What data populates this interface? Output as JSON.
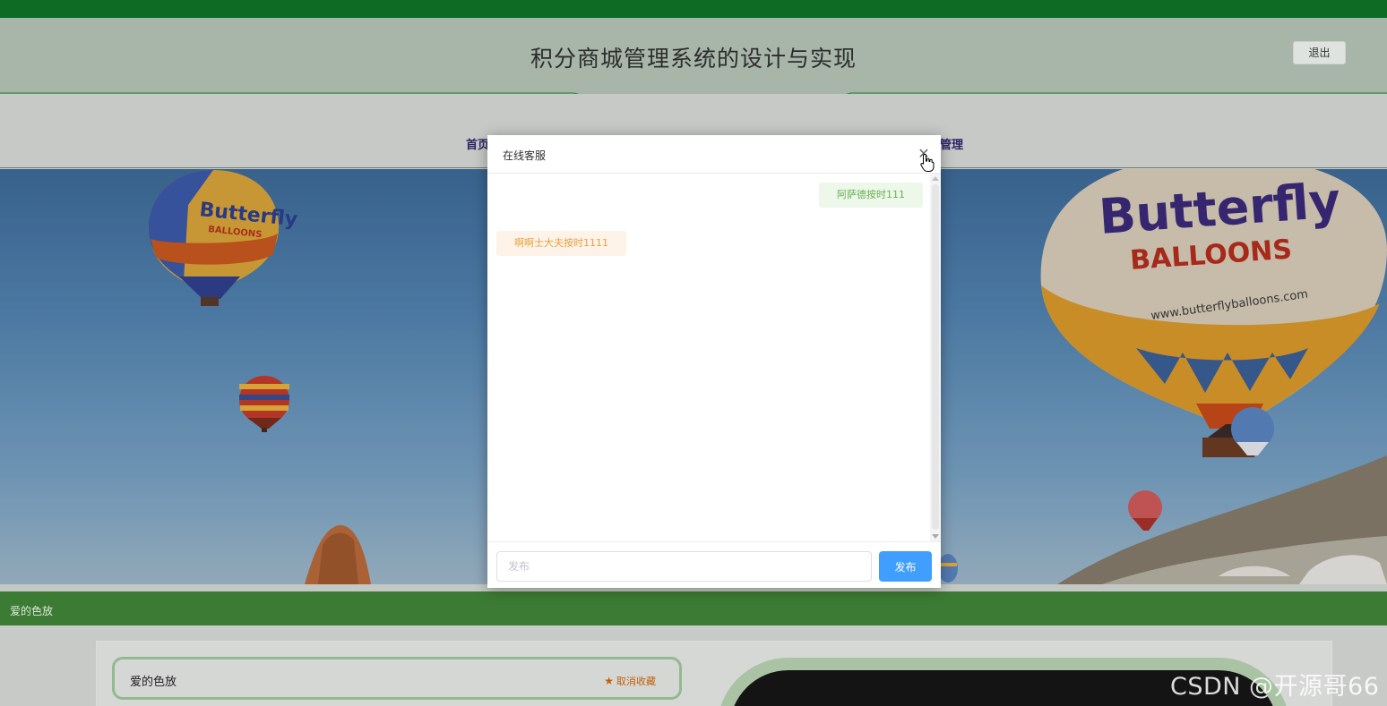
{
  "header": {
    "title": "积分商城管理系统的设计与实现",
    "logout_label": "退出"
  },
  "nav": {
    "home_partial": "首页",
    "manage_partial": "管理"
  },
  "banner": {
    "balloon_brand": "Butterfly",
    "balloon_sub": "BALLOONS",
    "balloon_url": "www.butterflyballoons.com"
  },
  "section": {
    "label": "爱的色放"
  },
  "favorite": {
    "item_name": "爱的色放",
    "action_label": "取消收藏",
    "action_icon": "star-icon"
  },
  "modal": {
    "title": "在线客服",
    "close_icon": "close-icon",
    "messages": [
      {
        "direction": "outgoing",
        "text": "阿萨德按时111"
      },
      {
        "direction": "incoming",
        "text": "啊啊士大夫按时1111"
      }
    ],
    "input_placeholder": "发布",
    "send_label": "发布"
  },
  "watermark": "CSDN @开源哥66",
  "colors": {
    "top_strip": "#0e6b23",
    "section_bar": "#3c7b33",
    "send_button": "#409eff",
    "outgoing_text": "#67b153",
    "incoming_text": "#e6a23c",
    "favorite_action": "#c0610a"
  }
}
